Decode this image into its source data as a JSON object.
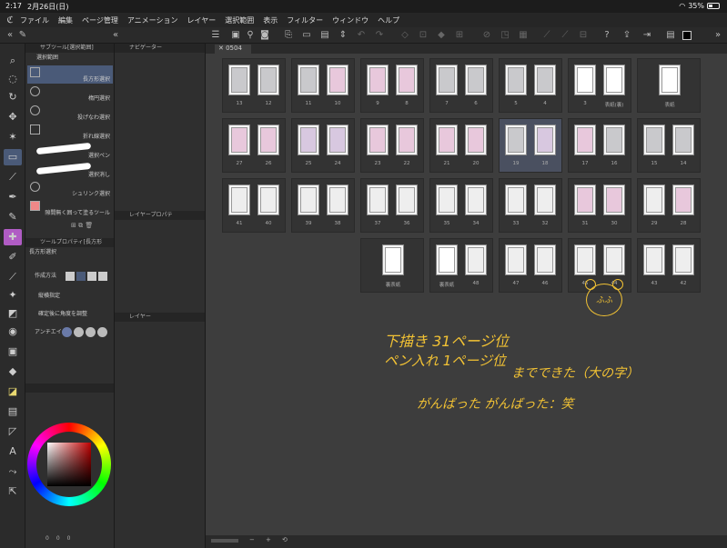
{
  "status": {
    "time": "2:17",
    "date": "2月26日(日)",
    "battery": "35%",
    "battery_level": 0.35
  },
  "menu": [
    "ファイル",
    "編集",
    "ページ管理",
    "アニメーション",
    "レイヤー",
    "選択範囲",
    "表示",
    "フィルター",
    "ウィンドウ",
    "ヘルプ"
  ],
  "panels": {
    "subtool_tab": "サブツール[選択範囲]",
    "subtool_header": "選択範囲",
    "subtools": [
      "長方形選択",
      "楕円選択",
      "投げなわ選択",
      "折れ線選択",
      "選択ペン",
      "選択消し",
      "シュリンク選択",
      "隙間無く囲って塗るツール"
    ],
    "navigator_tab": "ナビゲーター",
    "layer_prop_tab": "レイヤープロパテ",
    "toolprop_tab": "ツールプロパティ[長方形",
    "toolprop_title": "長方形選択",
    "toolprop_rows": [
      "作成方法",
      "縦横指定",
      "確定後に角度を調整",
      "アンチエイ"
    ],
    "layer_tab": "レイヤー",
    "color_values": [
      "0",
      "0",
      "0"
    ]
  },
  "canvas": {
    "tab_label": "0504",
    "spreads": [
      {
        "row": 0,
        "col": 0,
        "pages": [
          "13",
          "12"
        ],
        "art": [
          "gray",
          "gray"
        ]
      },
      {
        "row": 0,
        "col": 1,
        "pages": [
          "11",
          "10"
        ],
        "art": [
          "gray",
          "pink"
        ]
      },
      {
        "row": 0,
        "col": 2,
        "pages": [
          "9",
          "8"
        ],
        "art": [
          "pink",
          "pink"
        ]
      },
      {
        "row": 0,
        "col": 3,
        "pages": [
          "7",
          "6"
        ],
        "art": [
          "gray",
          "gray"
        ]
      },
      {
        "row": 0,
        "col": 4,
        "pages": [
          "5",
          "4"
        ],
        "art": [
          "gray",
          "gray"
        ]
      },
      {
        "row": 0,
        "col": 5,
        "pages": [
          "3",
          "表紙(裏)"
        ],
        "art": [
          "white",
          "white"
        ]
      },
      {
        "row": 0,
        "col": 6,
        "pages": [
          "表紙"
        ],
        "art": [
          "white"
        ]
      },
      {
        "row": 1,
        "col": 0,
        "pages": [
          "27",
          "26"
        ],
        "art": [
          "pink",
          "pink"
        ]
      },
      {
        "row": 1,
        "col": 1,
        "pages": [
          "25",
          "24"
        ],
        "art": [
          "mix",
          "mix"
        ]
      },
      {
        "row": 1,
        "col": 2,
        "pages": [
          "23",
          "22"
        ],
        "art": [
          "pink",
          "pink"
        ]
      },
      {
        "row": 1,
        "col": 3,
        "pages": [
          "21",
          "20"
        ],
        "art": [
          "pink",
          "pink"
        ]
      },
      {
        "row": 1,
        "col": 4,
        "pages": [
          "19",
          "18"
        ],
        "art": [
          "gray",
          "mix"
        ],
        "selected": true
      },
      {
        "row": 1,
        "col": 5,
        "pages": [
          "17",
          "16"
        ],
        "art": [
          "pink",
          "gray"
        ]
      },
      {
        "row": 1,
        "col": 6,
        "pages": [
          "15",
          "14"
        ],
        "art": [
          "gray",
          "gray"
        ]
      },
      {
        "row": 2,
        "col": 0,
        "pages": [
          "41",
          "40"
        ],
        "art": [
          "panels",
          "panels"
        ]
      },
      {
        "row": 2,
        "col": 1,
        "pages": [
          "39",
          "38"
        ],
        "art": [
          "panels",
          "panels"
        ]
      },
      {
        "row": 2,
        "col": 2,
        "pages": [
          "37",
          "36"
        ],
        "art": [
          "panels",
          "panels"
        ]
      },
      {
        "row": 2,
        "col": 3,
        "pages": [
          "35",
          "34"
        ],
        "art": [
          "panels",
          "panels"
        ]
      },
      {
        "row": 2,
        "col": 4,
        "pages": [
          "33",
          "32"
        ],
        "art": [
          "panels",
          "panels"
        ]
      },
      {
        "row": 2,
        "col": 5,
        "pages": [
          "31",
          "30"
        ],
        "art": [
          "pink",
          "pink"
        ]
      },
      {
        "row": 2,
        "col": 6,
        "pages": [
          "29",
          "28"
        ],
        "art": [
          "panels",
          "pink"
        ]
      },
      {
        "row": 3,
        "col": 2,
        "pages": [
          "裏表紙"
        ],
        "art": [
          "white"
        ]
      },
      {
        "row": 3,
        "col": 3,
        "pages": [
          "裏表紙",
          "48"
        ],
        "art": [
          "white",
          "panels"
        ]
      },
      {
        "row": 3,
        "col": 4,
        "pages": [
          "47",
          "46"
        ],
        "art": [
          "panels",
          "panels"
        ]
      },
      {
        "row": 3,
        "col": 5,
        "pages": [
          "45",
          "44"
        ],
        "art": [
          "panels",
          "panels"
        ]
      },
      {
        "row": 3,
        "col": 6,
        "pages": [
          "43",
          "42"
        ],
        "art": [
          "panels",
          "panels"
        ]
      }
    ]
  },
  "handwriting": {
    "line1": "下描き 31ページ位",
    "line2": "ペン入れ 1ページ位",
    "line3": "までできた（大の字）",
    "line4": "がんばった がんばった：笑",
    "doodle": "ふふ"
  },
  "colors": {
    "accent": "#4a5a78",
    "handwriting": "#f2c234",
    "canvas_bg": "#3d3d3d"
  }
}
